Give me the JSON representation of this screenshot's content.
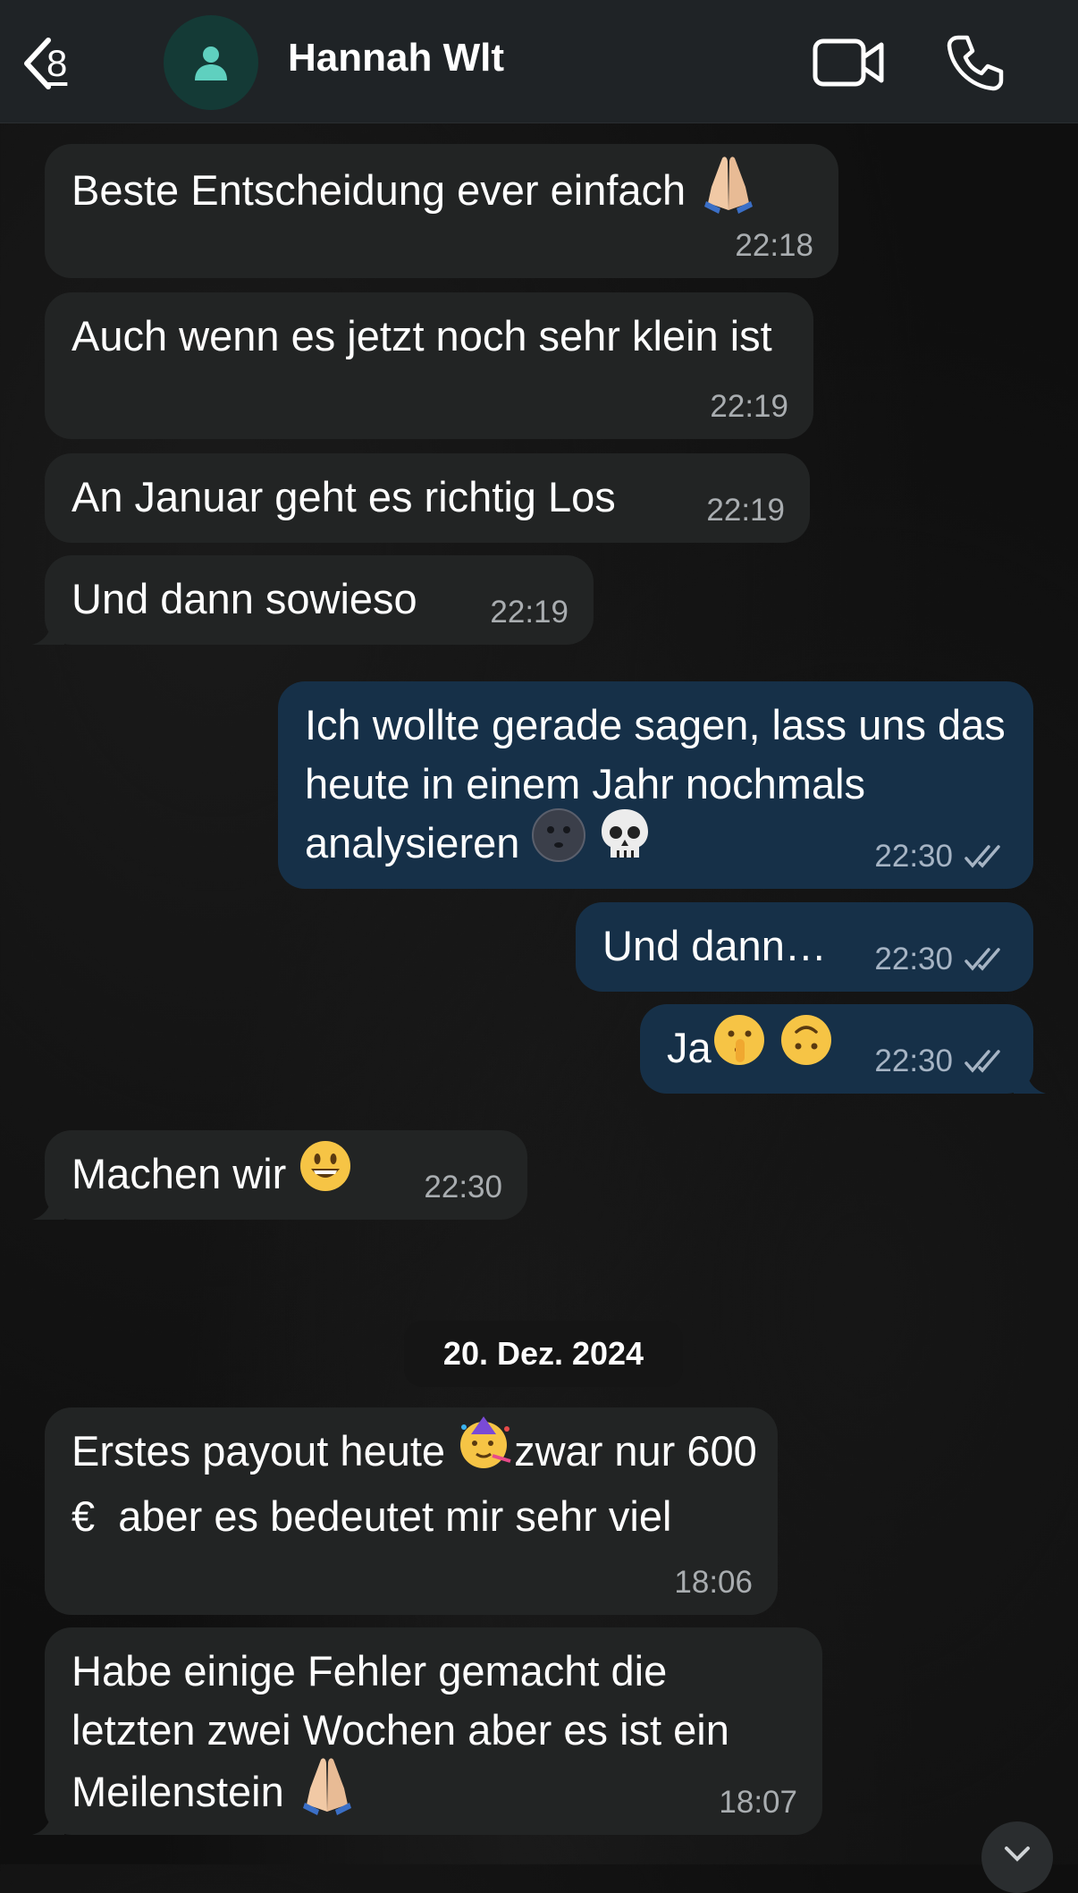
{
  "header": {
    "back_count": "8",
    "contact_name": "Hannah Wlt"
  },
  "messages": [
    {
      "dir": "in",
      "text": "Beste Entscheidung ever einfach",
      "emoji": [
        "pray"
      ],
      "time": "22:18"
    },
    {
      "dir": "in",
      "text": "Auch wenn es jetzt noch sehr klein ist",
      "emoji": [],
      "time": "22:19"
    },
    {
      "dir": "in",
      "text": "An Januar geht es richtig Los",
      "emoji": [],
      "time": "22:19"
    },
    {
      "dir": "in",
      "text": "Und dann sowieso",
      "emoji": [],
      "time": "22:19"
    },
    {
      "dir": "out",
      "text": "Ich wollte gerade sagen, lass uns das heute in einem Jahr nochmals analysieren",
      "emoji": [
        "new-moon-face",
        "skull"
      ],
      "time": "22:30",
      "status": "read"
    },
    {
      "dir": "out",
      "text": "Und dann…",
      "emoji": [],
      "time": "22:30",
      "status": "read"
    },
    {
      "dir": "out",
      "text": "Ja",
      "emoji": [
        "shushing-face",
        "upside-down-face"
      ],
      "time": "22:30",
      "status": "read"
    },
    {
      "dir": "in",
      "text": "Machen wir",
      "emoji": [
        "grinning-face"
      ],
      "time": "22:30"
    },
    {
      "dir": "in",
      "text": "Erstes payout heute",
      "text2": "zwar nur 600 €  aber es bedeutet mir sehr viel",
      "emoji": [
        "partying-face"
      ],
      "time": "18:06"
    },
    {
      "dir": "in",
      "text": "Habe einige Fehler gemacht die letzten zwei Wochen aber es ist ein Meilenstein",
      "emoji": [
        "pray"
      ],
      "time": "18:07"
    }
  ],
  "date_separator": "20. Dez. 2024",
  "colors": {
    "incoming_bubble": "#222424",
    "outgoing_bubble": "#163048",
    "header": "#1f2326",
    "avatar_bg": "#143a36",
    "avatar_icon": "#5fd0bf"
  }
}
